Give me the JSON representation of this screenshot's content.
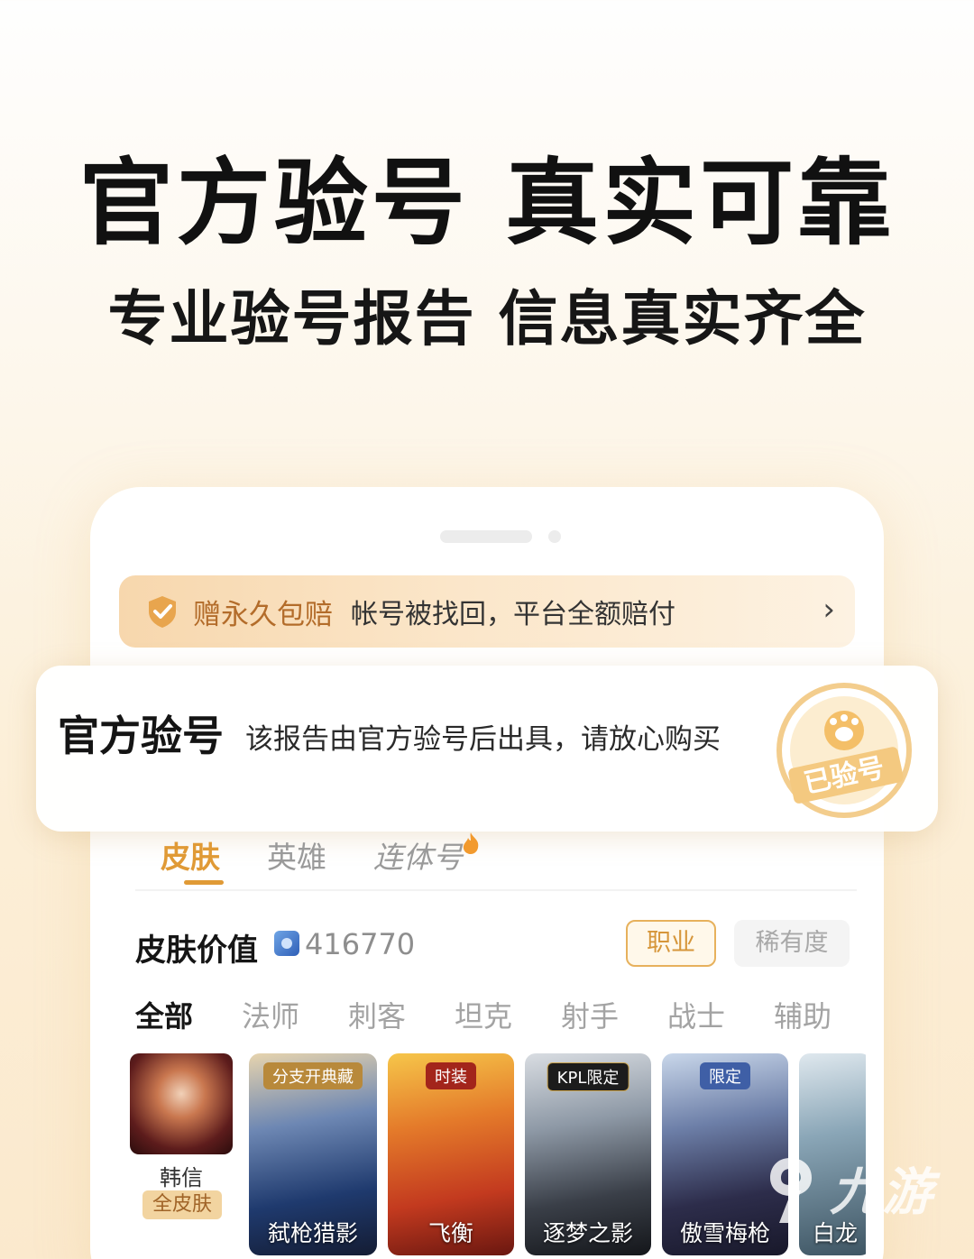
{
  "headline": "官方验号 真实可靠",
  "subheadline": "专业验号报告 信息真实齐全",
  "guarantee": {
    "title": "赠永久包赔",
    "desc": "帐号被找回，平台全额赔付"
  },
  "verify": {
    "title": "官方验号",
    "desc": "该报告由官方验号后出具，请放心购买",
    "stamp": "已验号"
  },
  "tabs": [
    "皮肤",
    "英雄",
    "连体号"
  ],
  "skin_value": {
    "label": "皮肤价值",
    "value": "416770"
  },
  "filters": {
    "job": "职业",
    "rarity": "稀有度"
  },
  "categories": [
    "全部",
    "法师",
    "刺客",
    "坦克",
    "射手",
    "战士",
    "辅助"
  ],
  "hero": {
    "name": "韩信",
    "tag": "全皮肤"
  },
  "skins": [
    {
      "name": "弑枪猎影",
      "badge": "分支开典藏"
    },
    {
      "name": "飞衡",
      "badge": "时装"
    },
    {
      "name": "逐梦之影",
      "badge": "KPL限定"
    },
    {
      "name": "傲雪梅枪",
      "badge": "限定"
    },
    {
      "name": "白龙",
      "badge": ""
    }
  ],
  "watermark": "九游",
  "colors": {
    "accent": "#e09a36",
    "guarantee_text": "#b36c2a"
  }
}
